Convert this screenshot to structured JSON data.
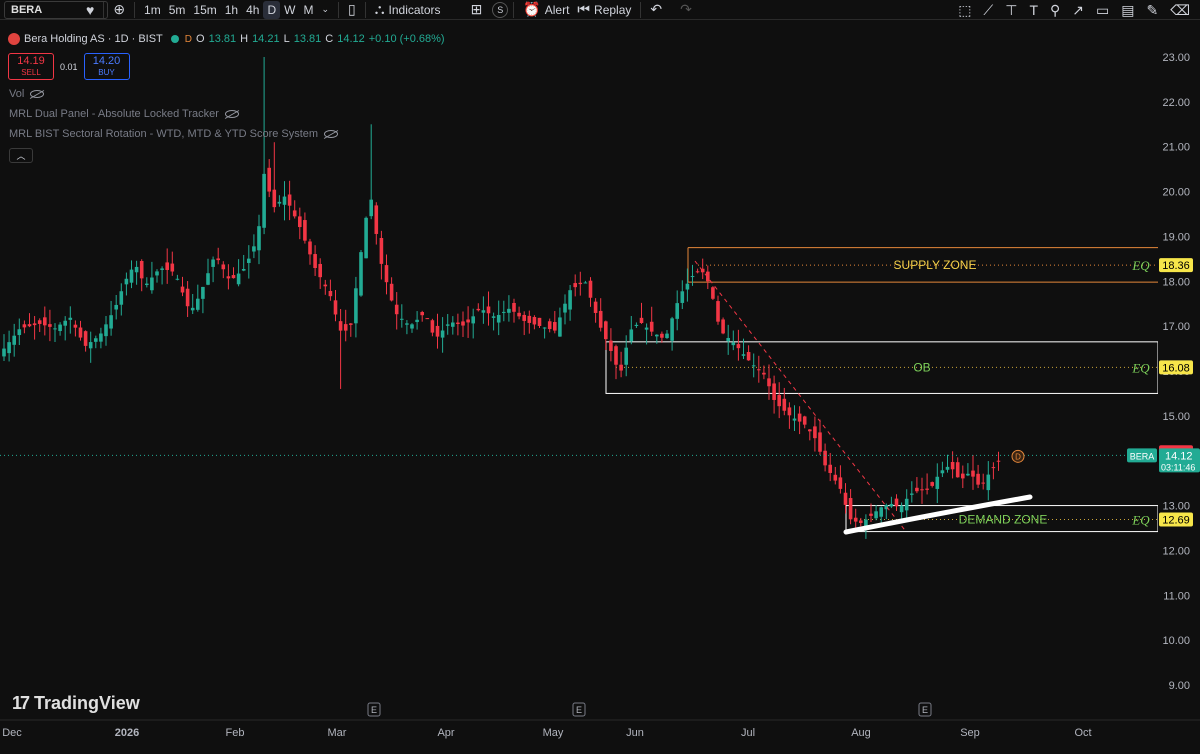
{
  "toolbar": {
    "symbol": "BERA",
    "timeframes": [
      "1m",
      "5m",
      "15m",
      "1h",
      "4h",
      "D",
      "W",
      "M"
    ],
    "active_timeframe": "D",
    "indicators_label": "Indicators",
    "alert_label": "Alert",
    "replay_label": "Replay",
    "s_label": "S"
  },
  "legend": {
    "title": "Bera Holding AS · 1D · BIST",
    "flag": "D",
    "o_label": "O",
    "o": "13.81",
    "h_label": "H",
    "h": "14.21",
    "l_label": "L",
    "l": "13.81",
    "c_label": "C",
    "c": "14.12",
    "change": "+0.10 (+0.68%)",
    "sell_price": "14.19",
    "sell_label": "SELL",
    "spread": "0.01",
    "buy_price": "14.20",
    "buy_label": "BUY",
    "indicators": [
      "Vol",
      "MRL Dual Panel - Absolute Locked Tracker",
      "MRL BIST Sectoral Rotation - WTD, MTD & YTD Score System"
    ]
  },
  "branding": {
    "name": "TradingView",
    "mark": "17"
  },
  "chart_data": {
    "type": "candlestick",
    "symbol": "BERA",
    "price_axis": {
      "min": 9.0,
      "max": 23.0,
      "ticks": [
        "23.00",
        "22.00",
        "21.00",
        "20.00",
        "19.00",
        "18.00",
        "17.00",
        "16.00",
        "15.00",
        "14.00",
        "13.00",
        "12.00",
        "11.00",
        "10.00",
        "9.00"
      ]
    },
    "time_axis": [
      "Dec",
      "2026",
      "Feb",
      "Mar",
      "Apr",
      "May",
      "Jun",
      "Jul",
      "Aug",
      "Sep",
      "Oct"
    ],
    "earnings_markers": [
      "E",
      "E",
      "E"
    ],
    "last_price": "14.12",
    "last_price_label": "BERA",
    "countdown": "03:11:46",
    "ask_price": "14.19",
    "zones": [
      {
        "name": "SUPPLY ZONE",
        "top": 18.75,
        "bottom": 17.98,
        "eq": "18.36",
        "eq_label": "EQ",
        "color": "#e5873a",
        "text_color": "#f7d24a"
      },
      {
        "name": "OB",
        "top": 16.65,
        "bottom": 15.5,
        "eq": "16.08",
        "eq_label": "EQ",
        "color": "#ffffff",
        "text_color": "#7ccf5a"
      },
      {
        "name": "DEMAND ZONE",
        "top": 13.0,
        "bottom": 12.42,
        "eq": "12.69",
        "eq_label": "EQ",
        "color": "#ffffff",
        "text_color": "#7ccf5a"
      }
    ],
    "colors": {
      "up": "#22ab94",
      "down": "#f23645",
      "background": "#0f0f0f",
      "eq_tag": "#f7e64a",
      "last_price_tag": "#22ab94",
      "ask_tag": "#f23645"
    }
  }
}
